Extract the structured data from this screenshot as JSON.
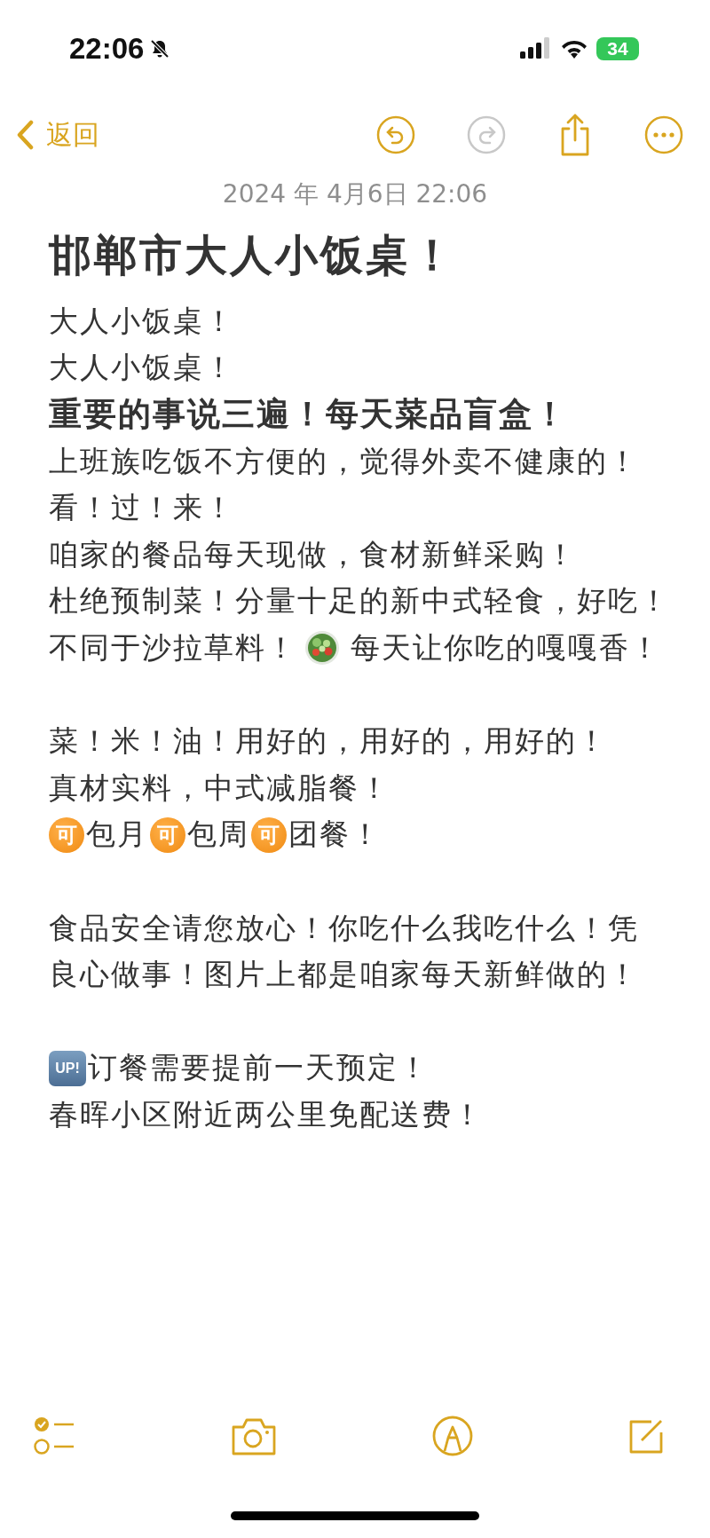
{
  "status_bar": {
    "time": "22:06",
    "battery": "34"
  },
  "nav": {
    "back": "返回",
    "undo": {
      "disabled": false
    },
    "redo": {
      "disabled": true
    }
  },
  "note": {
    "date": "2024 年 4月6日 22:06",
    "title": "邯郸市大人小饭桌！",
    "lines": [
      {
        "kind": "text",
        "segments": [
          {
            "kind": "text",
            "text": "大人小饭桌！"
          }
        ]
      },
      {
        "kind": "text",
        "segments": [
          {
            "kind": "text",
            "text": "大人小饭桌！"
          }
        ]
      },
      {
        "kind": "heading",
        "segments": [
          {
            "kind": "text",
            "text": "重要的事说三遍！每天菜品盲盒！"
          }
        ]
      },
      {
        "kind": "text",
        "segments": [
          {
            "kind": "text",
            "text": "上班族吃饭不方便的，觉得外卖不健康的！"
          }
        ]
      },
      {
        "kind": "text",
        "segments": [
          {
            "kind": "text",
            "text": "看！过！来！"
          }
        ]
      },
      {
        "kind": "text",
        "segments": [
          {
            "kind": "text",
            "text": "咱家的餐品每天现做，食材新鲜采购！"
          }
        ]
      },
      {
        "kind": "text",
        "segments": [
          {
            "kind": "text",
            "text": "杜绝预制菜！分量十足的新中式轻食，好吃！"
          }
        ]
      },
      {
        "kind": "text",
        "segments": [
          {
            "kind": "text",
            "text": "不同于沙拉草料！"
          },
          {
            "kind": "salad"
          },
          {
            "kind": "text",
            "text": "每天让你吃的嘎嘎香！"
          }
        ]
      },
      {
        "kind": "blank"
      },
      {
        "kind": "text",
        "segments": [
          {
            "kind": "text",
            "text": "菜！米！油！用好的，用好的，用好的！"
          }
        ]
      },
      {
        "kind": "text",
        "segments": [
          {
            "kind": "text",
            "text": "真材实料，中式减脂餐！"
          }
        ]
      },
      {
        "kind": "text",
        "segments": [
          {
            "kind": "ke",
            "text": "可"
          },
          {
            "kind": "text",
            "text": "包月"
          },
          {
            "kind": "ke",
            "text": "可"
          },
          {
            "kind": "text",
            "text": "包周"
          },
          {
            "kind": "ke",
            "text": "可"
          },
          {
            "kind": "text",
            "text": "团餐！"
          }
        ]
      },
      {
        "kind": "blank"
      },
      {
        "kind": "text",
        "segments": [
          {
            "kind": "text",
            "text": "食品安全请您放心！你吃什么我吃什么！凭"
          }
        ]
      },
      {
        "kind": "text",
        "segments": [
          {
            "kind": "text",
            "text": "良心做事！图片上都是咱家每天新鲜做的！"
          }
        ]
      },
      {
        "kind": "blank"
      },
      {
        "kind": "text",
        "segments": [
          {
            "kind": "up",
            "text": "UP!"
          },
          {
            "kind": "text",
            "text": "订餐需要提前一天预定！"
          }
        ]
      },
      {
        "kind": "text",
        "segments": [
          {
            "kind": "text",
            "text": "春晖小区附近两公里免配送费！"
          }
        ]
      }
    ]
  }
}
